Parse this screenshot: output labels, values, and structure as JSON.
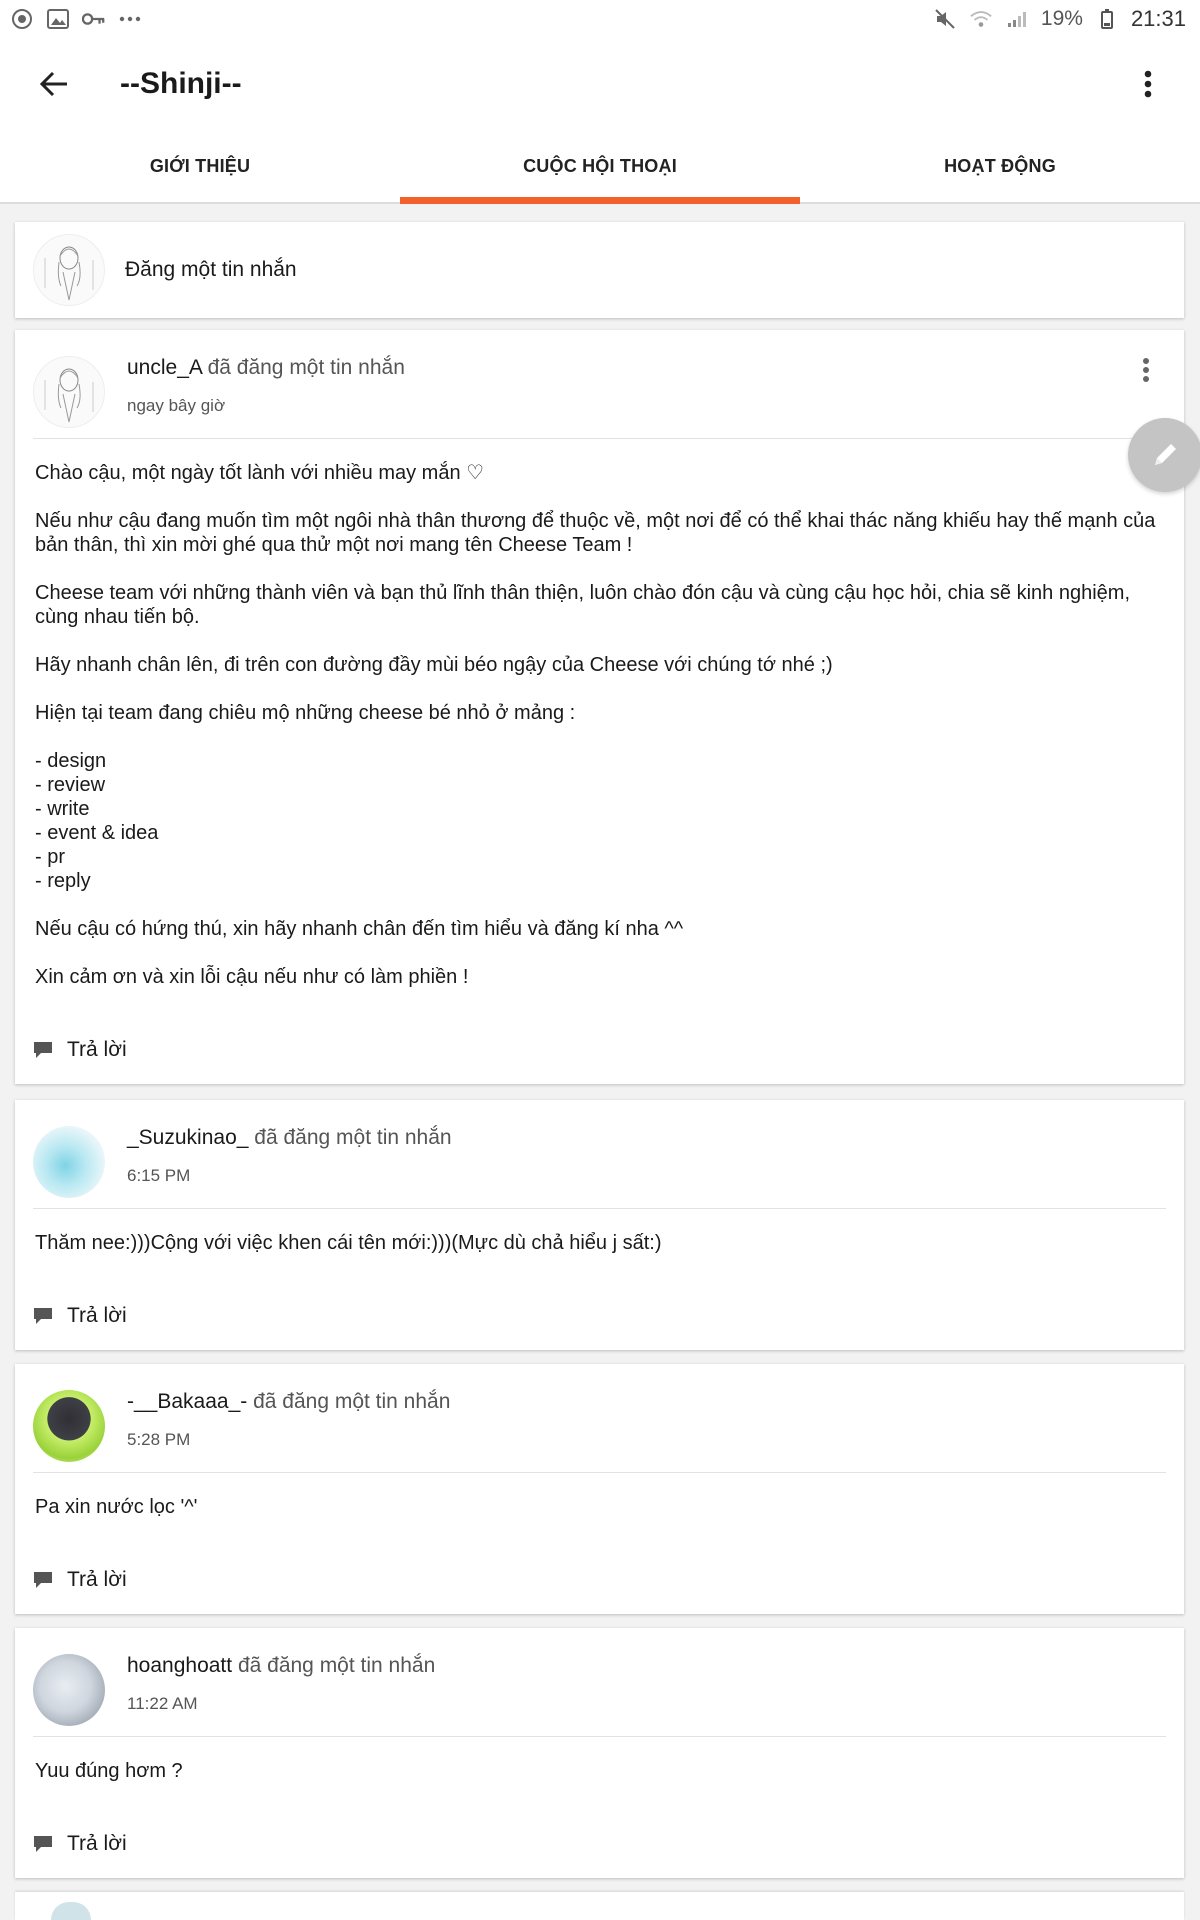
{
  "status_bar": {
    "battery": "19%",
    "time": "21:31",
    "icons_left": [
      "record-icon",
      "image-icon",
      "key-icon",
      "more-horiz-icon"
    ],
    "icons_right": [
      "mute-icon",
      "wifi-icon",
      "signal-icon",
      "battery-icon"
    ]
  },
  "app_bar": {
    "title": "--Shinji--"
  },
  "tabs": [
    {
      "label": "GIỚI THIỆU",
      "active": false
    },
    {
      "label": "CUỘC HỘI THOẠI",
      "active": true
    },
    {
      "label": "HOẠT ĐỘNG",
      "active": false
    }
  ],
  "accent_color": "#f2612c",
  "compose": {
    "label": "Đăng một tin nhắn"
  },
  "reply_label": "Trả lời",
  "posts": [
    {
      "user": "uncle_A",
      "action": " đã đăng một tin nhắn",
      "time": "ngay bây giờ",
      "paragraphs": [
        "Chào cậu, một ngày tốt lành với nhiều may mắn ♡",
        "Nếu như cậu đang muốn tìm một ngôi nhà thân thương để thuộc về, một nơi để có thể khai thác năng khiếu hay thế mạnh của bản thân, thì xin mời ghé qua thử một nơi mang tên Cheese Team !",
        "Cheese team với những thành viên và bạn thủ lĩnh thân thiện, luôn chào đón cậu và cùng cậu học hỏi, chia sẽ kinh nghiệm, cùng nhau tiến bộ.",
        "Hãy nhanh chân lên, đi trên con đường đầy mùi béo ngậy của Cheese với chúng tớ nhé ;)",
        "Hiện tại team đang chiêu mộ những cheese bé nhỏ ở mảng :"
      ],
      "list": [
        "- design",
        "- review",
        "- write",
        "- event & idea",
        "- pr",
        "- reply"
      ],
      "paragraphs_after": [
        "Nếu cậu có hứng thú, xin hãy nhanh chân đến tìm hiểu và đăng kí nha ^^",
        "Xin cảm ơn và xin lỗi cậu nếu như có làm phiền !"
      ]
    },
    {
      "user": "_Suzukinao_",
      "action": " đã đăng một tin nhắn",
      "time": "6:15 PM",
      "text": "Thăm nee:)))Cộng với việc khen cái tên mới:)))(Mực dù chả hiểu j sất:)"
    },
    {
      "user": "-__Bakaaa_-",
      "action": " đã đăng một tin nhắn",
      "time": "5:28 PM",
      "text": "Pa xin nước lọc '^'"
    },
    {
      "user": "hoanghoatt",
      "action": " đã đăng một tin nhắn",
      "time": "11:22 AM",
      "text": "Yuu đúng hơm ?"
    }
  ]
}
